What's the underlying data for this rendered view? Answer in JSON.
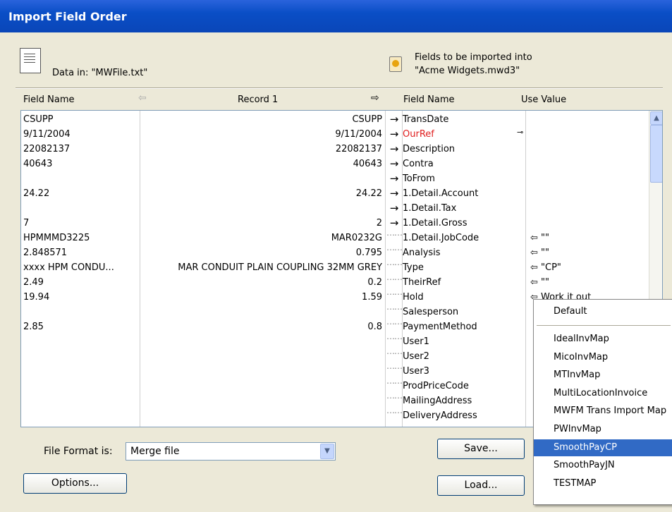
{
  "window": {
    "title": "Import Field Order"
  },
  "source": {
    "label": "Data in:  \"MWFile.txt\""
  },
  "target": {
    "line1": "Fields to be imported into",
    "line2": "\"Acme Widgets.mwd3\""
  },
  "headers": {
    "field_name": "Field Name",
    "record": "Record 1",
    "field_name2": "Field Name",
    "use_value": "Use Value"
  },
  "rows": [
    {
      "c1": "CSUPP",
      "c2": "CSUPP",
      "c3": "→",
      "c4": "TransDate",
      "c5": ""
    },
    {
      "c1": "9/11/2004",
      "c2": "9/11/2004",
      "c3": "→",
      "c4": "OurRef",
      "c5": ""
    },
    {
      "c1": "22082137",
      "c2": "22082137",
      "c3": "→",
      "c4": "Description",
      "c5": ""
    },
    {
      "c1": "40643",
      "c2": "40643",
      "c3": "→",
      "c4": "Contra",
      "c5": ""
    },
    {
      "c1": "",
      "c2": "",
      "c3": "→",
      "c4": "ToFrom",
      "c5": ""
    },
    {
      "c1": "24.22",
      "c2": "24.22",
      "c3": "→",
      "c4": "1.Detail.Account",
      "c5": ""
    },
    {
      "c1": "",
      "c2": "",
      "c3": "→",
      "c4": "1.Detail.Tax",
      "c5": ""
    },
    {
      "c1": "7",
      "c2": "2",
      "c3": "→",
      "c4": "1.Detail.Gross",
      "c5": ""
    },
    {
      "c1": "HPMMMD3225",
      "c2": "MAR0232G",
      "c3": "……",
      "c4": "1.Detail.JobCode",
      "c5": "⇦ \"\""
    },
    {
      "c1": "2.848571",
      "c2": "0.795",
      "c3": "……",
      "c4": "Analysis",
      "c5": "⇦ \"\""
    },
    {
      "c1": "xxxx HPM CONDU...",
      "c2": "MAR CONDUIT PLAIN COUPLING 32MM GREY",
      "c3": "……",
      "c4": "Type",
      "c5": "⇦ \"CP\""
    },
    {
      "c1": "2.49",
      "c2": "0.2",
      "c3": "……",
      "c4": "TheirRef",
      "c5": "⇦ \"\""
    },
    {
      "c1": "19.94",
      "c2": "1.59",
      "c3": "……",
      "c4": "Hold",
      "c5": "⇦ Work it out"
    },
    {
      "c1": "",
      "c2": "",
      "c3": "……",
      "c4": "Salesperson",
      "c5": ""
    },
    {
      "c1": "2.85",
      "c2": "0.8",
      "c3": "……",
      "c4": "PaymentMethod",
      "c5": ""
    },
    {
      "c1": "",
      "c2": "",
      "c3": "……",
      "c4": "User1",
      "c5": ""
    },
    {
      "c1": "",
      "c2": "",
      "c3": "……",
      "c4": "User2",
      "c5": ""
    },
    {
      "c1": "",
      "c2": "",
      "c3": "……",
      "c4": "User3",
      "c5": ""
    },
    {
      "c1": "",
      "c2": "",
      "c3": "……",
      "c4": "ProdPriceCode",
      "c5": ""
    },
    {
      "c1": "",
      "c2": "",
      "c3": "……",
      "c4": "MailingAddress",
      "c5": ""
    },
    {
      "c1": "",
      "c2": "",
      "c3": "……",
      "c4": "DeliveryAddress",
      "c5": ""
    }
  ],
  "colors": {
    "highlight_field": "#e02020",
    "selection": "#316ac5",
    "titlebar": "#0a4ec6"
  },
  "format": {
    "label": "File Format is:",
    "value": "Merge file"
  },
  "buttons": {
    "options": "Options...",
    "save": "Save...",
    "load": "Load..."
  },
  "menu": {
    "header": "Default",
    "items": [
      "IdealInvMap",
      "MicoInvMap",
      "MTInvMap",
      "MultiLocationInvoice",
      "MWFM Trans Import Map",
      "PWInvMap",
      "SmoothPayCP",
      "SmoothPayJN",
      "TESTMAP"
    ],
    "selected": "SmoothPayCP"
  },
  "icons": {
    "file": "text-file-icon",
    "database": "database-file-icon",
    "key": "key-icon",
    "left": "left-arrow-icon",
    "right": "right-arrow-icon"
  }
}
